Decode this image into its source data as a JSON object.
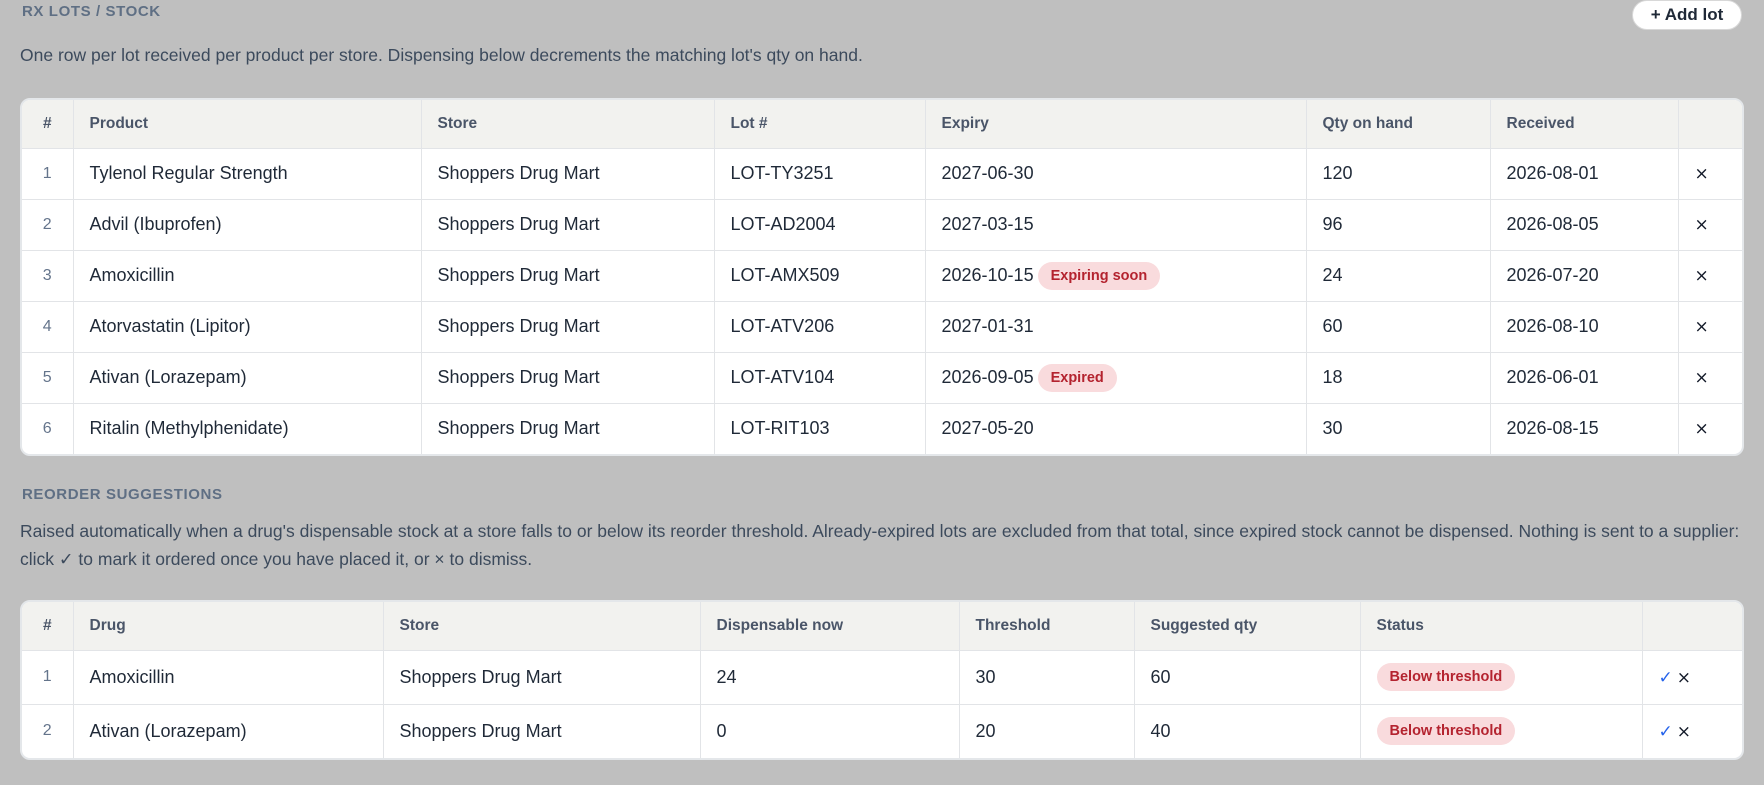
{
  "lots": {
    "title": "RX LOTS / STOCK",
    "add_button": "+ Add lot",
    "description": "One row per lot received per product per store. Dispensing below decrements the matching lot's qty on hand.",
    "columns": [
      "#",
      "Product",
      "Store",
      "Lot #",
      "Expiry",
      "Qty on hand",
      "Received",
      ""
    ],
    "rows": [
      {
        "num": "1",
        "product": "Tylenol Regular Strength",
        "store": "Shoppers Drug Mart",
        "lot": "LOT-TY3251",
        "expiry": "2027-06-30",
        "badge": "",
        "qty": "120",
        "received": "2026-08-01"
      },
      {
        "num": "2",
        "product": "Advil (Ibuprofen)",
        "store": "Shoppers Drug Mart",
        "lot": "LOT-AD2004",
        "expiry": "2027-03-15",
        "badge": "",
        "qty": "96",
        "received": "2026-08-05"
      },
      {
        "num": "3",
        "product": "Amoxicillin",
        "store": "Shoppers Drug Mart",
        "lot": "LOT-AMX509",
        "expiry": "2026-10-15",
        "badge": "Expiring soon",
        "qty": "24",
        "received": "2026-07-20"
      },
      {
        "num": "4",
        "product": "Atorvastatin (Lipitor)",
        "store": "Shoppers Drug Mart",
        "lot": "LOT-ATV206",
        "expiry": "2027-01-31",
        "badge": "",
        "qty": "60",
        "received": "2026-08-10"
      },
      {
        "num": "5",
        "product": "Ativan (Lorazepam)",
        "store": "Shoppers Drug Mart",
        "lot": "LOT-ATV104",
        "expiry": "2026-09-05",
        "badge": "Expired",
        "qty": "18",
        "received": "2026-06-01"
      },
      {
        "num": "6",
        "product": "Ritalin (Methylphenidate)",
        "store": "Shoppers Drug Mart",
        "lot": "LOT-RIT103",
        "expiry": "2027-05-20",
        "badge": "",
        "qty": "30",
        "received": "2026-08-15"
      }
    ],
    "delete_symbol": "×"
  },
  "reorder": {
    "title": "REORDER SUGGESTIONS",
    "description_line1": "Raised automatically when a drug's dispensable stock at a store falls to or below its reorder threshold. Already-expired lots are excluded from that total, since expired stock cannot be dispensed. Nothing is sent to a supplier:",
    "description_line2": "click ✓ to mark it ordered once you have placed it, or × to dismiss.",
    "columns": [
      "#",
      "Drug",
      "Store",
      "Dispensable now",
      "Threshold",
      "Suggested qty",
      "Status",
      ""
    ],
    "rows": [
      {
        "num": "1",
        "drug": "Amoxicillin",
        "store": "Shoppers Drug Mart",
        "dispensable": "24",
        "threshold": "30",
        "suggested": "60",
        "status": "Below threshold"
      },
      {
        "num": "2",
        "drug": "Ativan (Lorazepam)",
        "store": "Shoppers Drug Mart",
        "dispensable": "0",
        "threshold": "20",
        "suggested": "40",
        "status": "Below threshold"
      }
    ],
    "check_symbol": "✓",
    "dismiss_symbol": "×"
  },
  "colors": {
    "background": "#bfbfbf",
    "badge_bg": "#f9dbdd",
    "badge_text": "#b4232f",
    "check": "#2563eb"
  }
}
